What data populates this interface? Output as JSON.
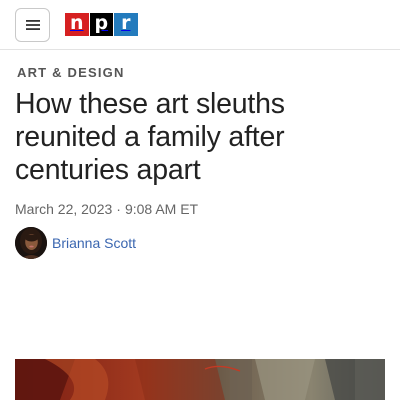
{
  "header": {
    "menu_icon": "hamburger-menu-icon",
    "logo": {
      "letters": [
        "n",
        "p",
        "r"
      ],
      "colors": [
        "#d62021",
        "#000000",
        "#237bbd"
      ]
    }
  },
  "article": {
    "section": "ART & DESIGN",
    "headline": "How these art sleuths reunited a family after centuries apart",
    "date": "March 22, 2023",
    "separator": "·",
    "time": "9:08 AM ET",
    "author": "Brianna Scott"
  },
  "colors": {
    "author_link": "#3a66b0",
    "divider": "#e3e3e3"
  }
}
